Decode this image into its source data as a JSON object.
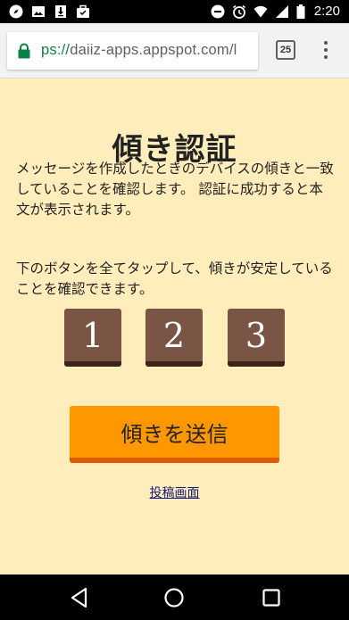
{
  "status_bar": {
    "left_icons": [
      "compass-icon",
      "image-icon",
      "download-icon",
      "briefcase-icon"
    ],
    "right_icons": [
      "minus-circle-icon",
      "alarm-icon",
      "wifi-icon",
      "signal-icon",
      "battery-icon"
    ],
    "time": "2:20"
  },
  "browser": {
    "url_scheme": "ps://",
    "url_host": "daiiz-apps.appspot.com/l",
    "tab_count": "25"
  },
  "page": {
    "title": "傾き認証",
    "paragraph1": "メッセージを作成したときのデバイスの傾きと一致していることを確認します。 認証に成功すると本文が表示されます。",
    "paragraph2": "下のボタンを全てタップして、傾きが安定していることを確認できます。",
    "tiles": [
      "1",
      "2",
      "3"
    ],
    "send_button": "傾きを送信",
    "post_link": "投稿画面"
  },
  "colors": {
    "background": "#ffeebb",
    "tile": "#7a5444",
    "button": "#ff9800",
    "url_scheme": "#0b8043"
  }
}
